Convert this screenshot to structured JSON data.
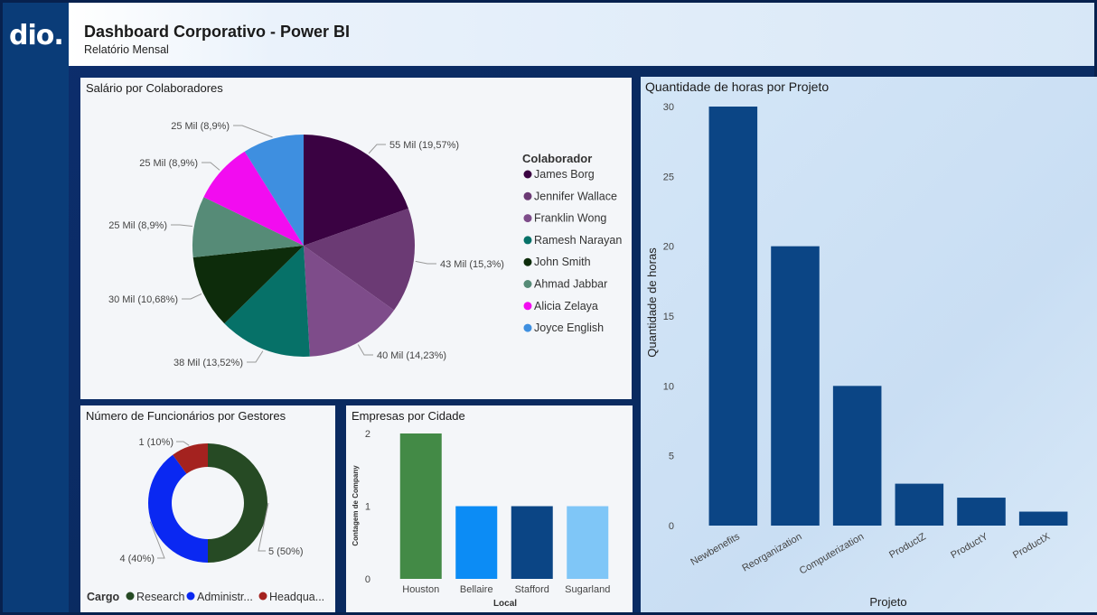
{
  "header": {
    "logo_text": "dio.",
    "title": "Dashboard Corporativo - Power BI",
    "subtitle": "Relatório Mensal"
  },
  "salary_panel": {
    "title": "Salário por Colaboradores",
    "legend_title": "Colaborador"
  },
  "hours_panel": {
    "title": "Quantidade de horas por Projeto"
  },
  "managers_panel": {
    "title": "Número de Funcionários por Gestores",
    "legend_title": "Cargo"
  },
  "cities_panel": {
    "title": "Empresas por Cidade"
  },
  "chart_data": [
    {
      "type": "pie",
      "title": "Salário por Colaboradores",
      "legend_title": "Colaborador",
      "categories": [
        "James Borg",
        "Jennifer Wallace",
        "Franklin Wong",
        "Ramesh Narayan",
        "John Smith",
        "Ahmad Jabbar",
        "Alicia Zelaya",
        "Joyce English"
      ],
      "values": [
        55,
        43,
        40,
        38,
        30,
        25,
        25,
        25
      ],
      "labels": [
        "55 Mil (19,57%)",
        "43 Mil (15,3%)",
        "40 Mil (14,23%)",
        "38 Mil (13,52%)",
        "30 Mil (10,68%)",
        "25 Mil (8,9%)",
        "25 Mil (8,9%)",
        "25 Mil (8,9%)"
      ],
      "colors": [
        "#3a0242",
        "#6b3a74",
        "#7e4c8a",
        "#067168",
        "#0d2c0b",
        "#568b77",
        "#f20cf0",
        "#3e8fe0"
      ]
    },
    {
      "type": "bar",
      "title": "Quantidade de horas por Projeto",
      "categories": [
        "Newbenefits",
        "Reorganization",
        "Computerization",
        "ProductZ",
        "ProductY",
        "ProductX"
      ],
      "values": [
        30,
        20,
        10,
        3,
        2,
        1
      ],
      "xlabel": "Projeto",
      "ylabel": "Quantidade de horas",
      "yticks": [
        "0",
        "5",
        "10",
        "15",
        "20",
        "25",
        "30"
      ],
      "ylim": [
        0,
        30
      ],
      "color": "#0b4585"
    },
    {
      "type": "pie",
      "title": "Número de Funcionários por Gestores",
      "legend_title": "Cargo",
      "categories": [
        "Research",
        "Administr...",
        "Headqua..."
      ],
      "values": [
        5,
        4,
        1
      ],
      "labels": [
        "5 (50%)",
        "4 (40%)",
        "1 (10%)"
      ],
      "colors": [
        "#264a24",
        "#0a28f2",
        "#a4221f"
      ]
    },
    {
      "type": "bar",
      "title": "Empresas por Cidade",
      "categories": [
        "Houston",
        "Bellaire",
        "Stafford",
        "Sugarland"
      ],
      "values": [
        2,
        1,
        1,
        1
      ],
      "xlabel": "Local",
      "ylabel": "Contagem de Company",
      "yticks": [
        "0",
        "1",
        "2"
      ],
      "ylim": [
        0,
        2
      ],
      "colors": [
        "#438a46",
        "#0c8cf5",
        "#0b4585",
        "#7fc6f7"
      ]
    }
  ]
}
